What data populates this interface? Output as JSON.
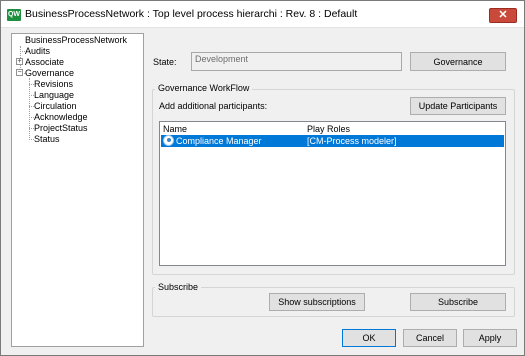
{
  "window": {
    "title": "BusinessProcessNetwork : Top level process hierarchi : Rev. 8  : Default",
    "app_icon_text": "QW",
    "close_glyph": "✕"
  },
  "tree": {
    "items": [
      {
        "label": "BusinessProcessNetwork"
      },
      {
        "label": "Audits"
      },
      {
        "label": "Associate"
      },
      {
        "label": "Governance"
      },
      {
        "label": "Revisions"
      },
      {
        "label": "Language"
      },
      {
        "label": "Circulation"
      },
      {
        "label": "Acknowledge"
      },
      {
        "label": "ProjectStatus"
      },
      {
        "label": "Status"
      }
    ],
    "expand_plus": "+",
    "expand_minus": "−"
  },
  "state": {
    "label": "State:",
    "value": "Development",
    "governance_button": "Governance"
  },
  "workflow": {
    "group_title": "Governance WorkFlow",
    "participants_label": "Add additional participants:",
    "update_button": "Update Participants",
    "columns": [
      "Name",
      "Play Roles"
    ],
    "rows": [
      {
        "name": "Compliance Manager",
        "roles": "[CM-Process modeler]"
      }
    ]
  },
  "subscribe": {
    "group_title": "Subscribe",
    "show_button": "Show subscriptions",
    "subscribe_button": "Subscribe"
  },
  "footer": {
    "ok": "OK",
    "cancel": "Cancel",
    "apply": "Apply"
  },
  "colors": {
    "selection": "#0078d7",
    "close_button": "#c94a3a",
    "app_icon": "#1d8f3e"
  }
}
